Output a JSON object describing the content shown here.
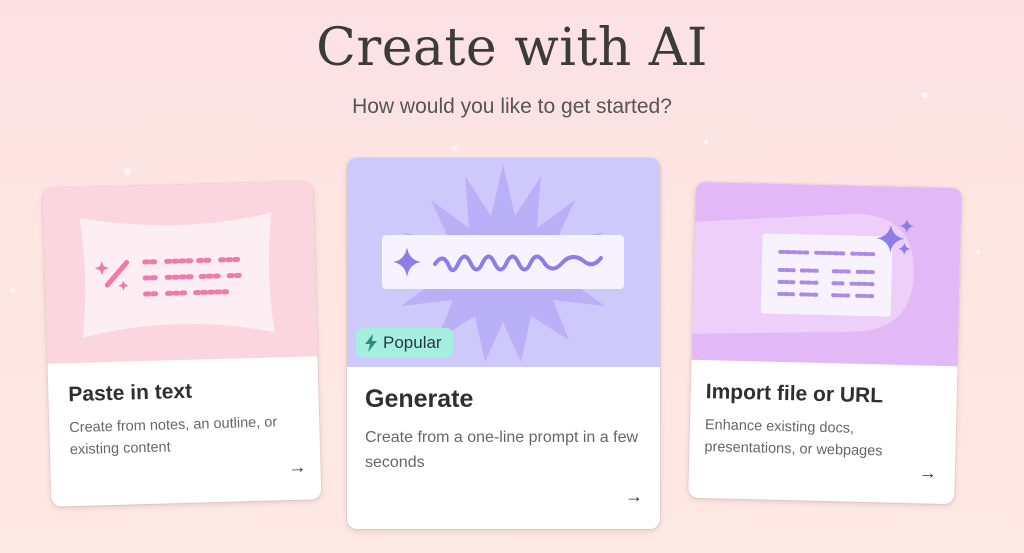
{
  "header": {
    "title": "Create with AI",
    "subtitle": "How would you like to get started?"
  },
  "cards": [
    {
      "id": "paste",
      "title": "Paste in text",
      "description": "Create from notes, an outline, or existing content",
      "icon": "wand-sparkle-icon",
      "accent": "#fcd6de"
    },
    {
      "id": "generate",
      "title": "Generate",
      "description": "Create from a one-line prompt in a few seconds",
      "badge": "Popular",
      "icon": "sparkle-icon",
      "accent": "#cec9fb",
      "badge_color": "#a6efe0"
    },
    {
      "id": "import",
      "title": "Import file or URL",
      "description": "Enhance existing docs, presentations, or webpages",
      "icon": "sparkles-icon",
      "accent": "#e2b9f6"
    }
  ],
  "arrow_glyph": "→"
}
